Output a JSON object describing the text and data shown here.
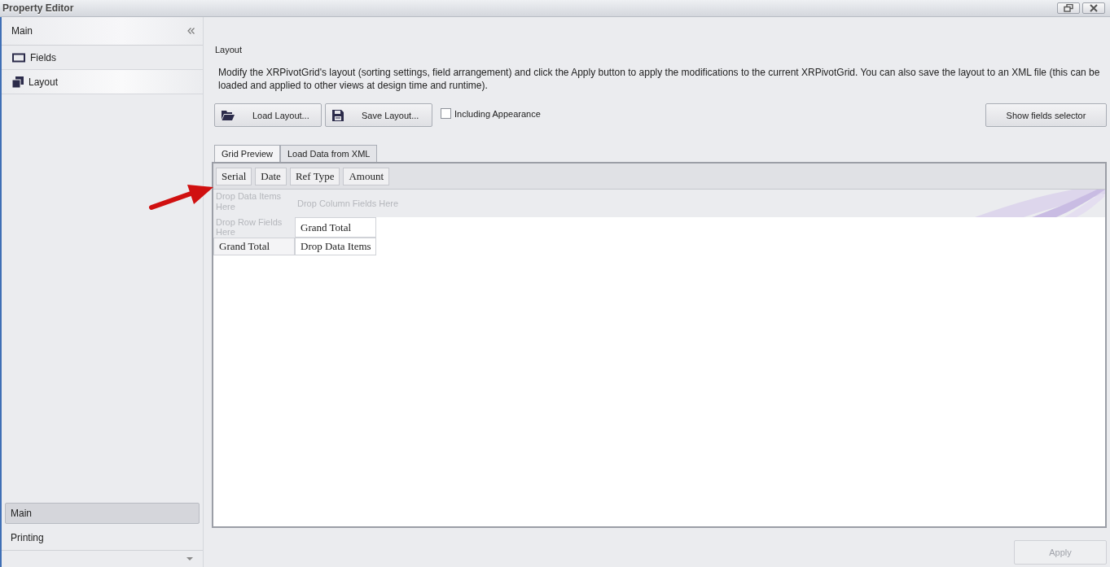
{
  "window": {
    "title": "Property Editor"
  },
  "sidebar": {
    "group": {
      "title": "Main",
      "expanded": true
    },
    "items": [
      {
        "label": "Fields",
        "kind": "fields",
        "selected": false
      },
      {
        "label": "Layout",
        "kind": "layout",
        "selected": true
      }
    ],
    "nav_groups": [
      {
        "label": "Main",
        "selected": true
      },
      {
        "label": "Printing",
        "selected": false
      }
    ]
  },
  "content": {
    "heading": "Layout",
    "description": "Modify the XRPivotGrid's layout (sorting settings, field arrangement) and click the Apply button to apply the modifications to the current XRPivotGrid. You can also save the layout to an XML file (this can be loaded and applied to other views at design time and runtime).",
    "toolbar": [
      {
        "label": "Load Layout...",
        "kind": "open"
      },
      {
        "label": "Save Layout...",
        "kind": "save"
      }
    ],
    "checkbox": {
      "label": "Including Appearance",
      "checked": false
    },
    "show_fields_button": "Show fields selector",
    "tabs": [
      {
        "label": "Grid Preview",
        "selected": true
      },
      {
        "label": "Load Data from XML",
        "selected": false
      }
    ],
    "pivot": {
      "fields": [
        "Serial",
        "Date",
        "Ref Type",
        "Amount"
      ],
      "data_hint": "Drop Data Items Here",
      "column_hint": "Drop Column Fields Here",
      "row_hint": "Drop Row Fields Here",
      "column_total": "Grand Total",
      "row_total": "Grand Total",
      "cell": "Drop Data Items"
    },
    "apply_button": {
      "label": "Apply",
      "disabled": true
    }
  }
}
